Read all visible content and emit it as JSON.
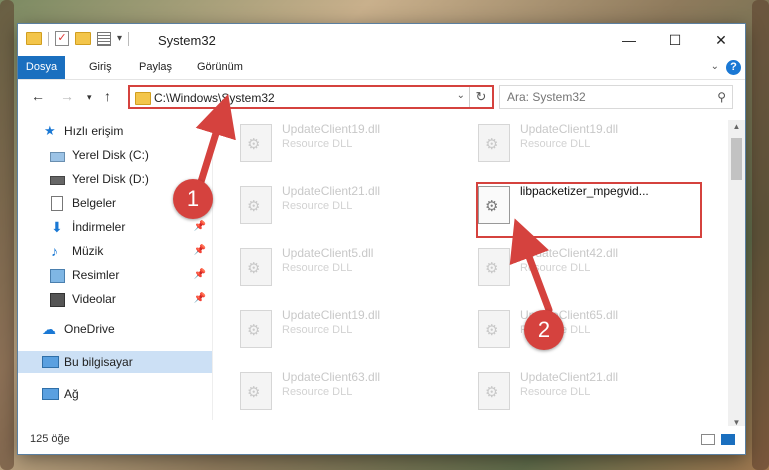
{
  "window": {
    "title": "System32",
    "controls": {
      "minimize": "—",
      "maximize": "☐",
      "close": "✕"
    }
  },
  "ribbon": {
    "tabs": [
      "Dosya",
      "Giriş",
      "Paylaş",
      "Görünüm"
    ],
    "help": "?"
  },
  "nav": {
    "address": "C:\\Windows\\System32",
    "search_placeholder": "Ara: System32"
  },
  "sidebar": {
    "items": [
      {
        "label": "Hızlı erişim",
        "icon": "star-icon"
      },
      {
        "label": "Yerel Disk (C:)",
        "icon": "drive-icon"
      },
      {
        "label": "Yerel Disk (D:)",
        "icon": "drive-icon"
      },
      {
        "label": "Belgeler",
        "icon": "document-icon"
      },
      {
        "label": "İndirmeler",
        "icon": "download-icon",
        "pinned": true
      },
      {
        "label": "Müzik",
        "icon": "music-icon",
        "pinned": true
      },
      {
        "label": "Resimler",
        "icon": "pictures-icon",
        "pinned": true
      },
      {
        "label": "Videolar",
        "icon": "video-icon",
        "pinned": true
      },
      {
        "label": "OneDrive",
        "icon": "cloud-icon"
      },
      {
        "label": "Bu bilgisayar",
        "icon": "computer-icon",
        "selected": true
      },
      {
        "label": "Ağ",
        "icon": "network-icon"
      }
    ]
  },
  "files": [
    {
      "name": "UpdateClient19.dll",
      "type": "Resource DLL"
    },
    {
      "name": "UpdateClient19.dll",
      "type": "Resource DLL"
    },
    {
      "name": "UpdateClient21.dll",
      "type": "Resource DLL"
    },
    {
      "name": "libpacketizer_mpegvid...",
      "type": "",
      "highlighted": true
    },
    {
      "name": "UpdateClient5.dll",
      "type": "Resource DLL"
    },
    {
      "name": "UpdateClient42.dll",
      "type": "Resource DLL"
    },
    {
      "name": "UpdateClient19.dll",
      "type": "Resource DLL"
    },
    {
      "name": "UpdateClient65.dll",
      "type": "Resource DLL"
    },
    {
      "name": "UpdateClient63.dll",
      "type": "Resource DLL"
    },
    {
      "name": "UpdateClient21.dll",
      "type": "Resource DLL"
    }
  ],
  "status": {
    "count": "125 öğe"
  },
  "annotations": {
    "step1": "1",
    "step2": "2",
    "color": "#d5423e"
  }
}
